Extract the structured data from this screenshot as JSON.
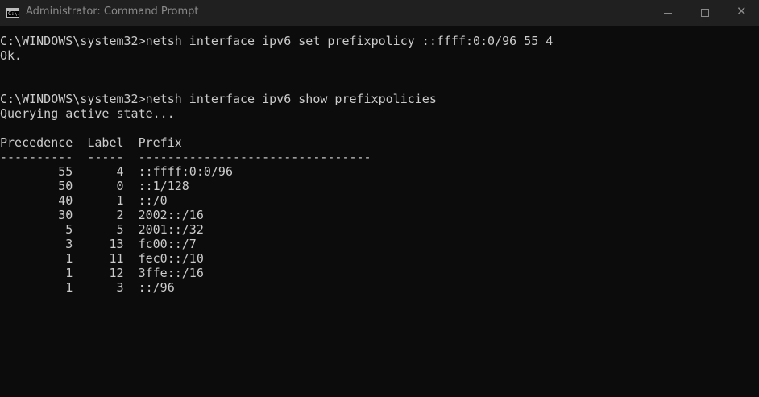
{
  "window": {
    "icon_text": "C:\\.",
    "title": "Administrator: Command Prompt",
    "controls": {
      "minimize": "minimize",
      "maximize": "maximize",
      "close": "close"
    }
  },
  "console": {
    "lines": [
      "C:\\WINDOWS\\system32>netsh interface ipv6 set prefixpolicy ::ffff:0:0/96 55 4",
      "Ok.",
      "",
      "",
      "C:\\WINDOWS\\system32>netsh interface ipv6 show prefixpolicies",
      "Querying active state...",
      "",
      "Precedence  Label  Prefix",
      "----------  -----  --------------------------------",
      "        55      4  ::ffff:0:0/96",
      "        50      0  ::1/128",
      "        40      1  ::/0",
      "        30      2  2002::/16",
      "         5      5  2001::/32",
      "         3     13  fc00::/7",
      "         1     11  fec0::/10",
      "         1     12  3ffe::/16",
      "         1      3  ::/96"
    ]
  },
  "colors": {
    "background": "#0c0c0c",
    "titlebar": "#202020",
    "text": "#cccccc",
    "title_text": "#8a8a8a"
  }
}
